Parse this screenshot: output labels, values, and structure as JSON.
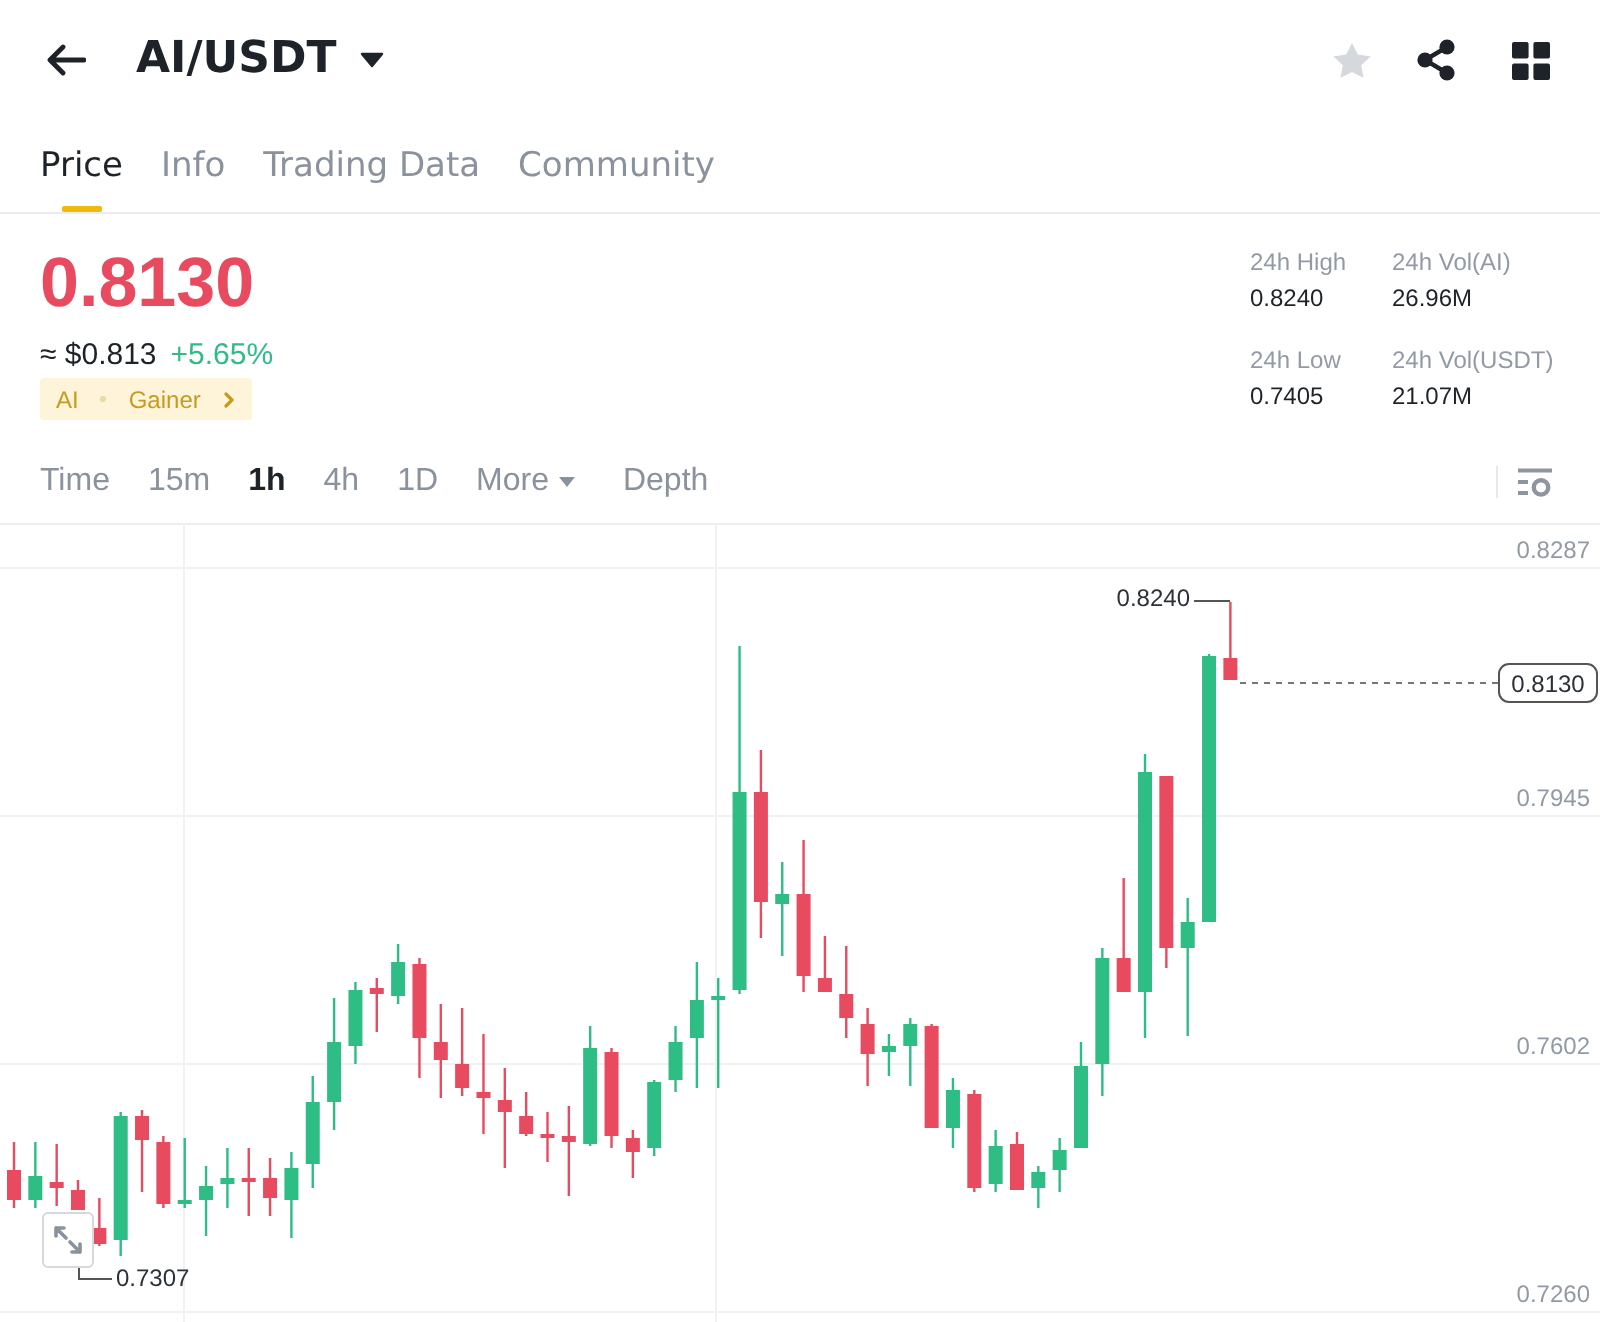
{
  "header": {
    "title": "AI/USDT",
    "favorited": false
  },
  "tabs": [
    {
      "label": "Price",
      "selected": true
    },
    {
      "label": "Info",
      "selected": false
    },
    {
      "label": "Trading Data",
      "selected": false
    },
    {
      "label": "Community",
      "selected": false
    }
  ],
  "price": {
    "last": "0.8130",
    "last_down": true,
    "approx": "≈ $0.813",
    "change": "+5.65%",
    "change_up": true,
    "tags": [
      "AI",
      "Gainer"
    ]
  },
  "stats": [
    {
      "label": "24h High",
      "value": "0.8240"
    },
    {
      "label": "24h Vol(AI)",
      "value": "26.96M"
    },
    {
      "label": "24h Low",
      "value": "0.7405"
    },
    {
      "label": "24h Vol(USDT)",
      "value": "21.07M"
    }
  ],
  "intervals": [
    {
      "label": "Time",
      "kind": "tab",
      "selected": false
    },
    {
      "label": "15m",
      "kind": "tab",
      "selected": false
    },
    {
      "label": "1h",
      "kind": "tab",
      "selected": true
    },
    {
      "label": "4h",
      "kind": "tab",
      "selected": false
    },
    {
      "label": "1D",
      "kind": "tab",
      "selected": false
    },
    {
      "label": "More",
      "kind": "dropdown",
      "selected": false
    },
    {
      "label": "Depth",
      "kind": "tab",
      "selected": false
    }
  ],
  "chart": {
    "price_ticks": [
      "0.8287",
      "0.7945",
      "0.7602",
      "0.7260"
    ],
    "high_label": "0.8240",
    "low_label": "0.7307",
    "last_price_tag": "0.8130"
  }
}
